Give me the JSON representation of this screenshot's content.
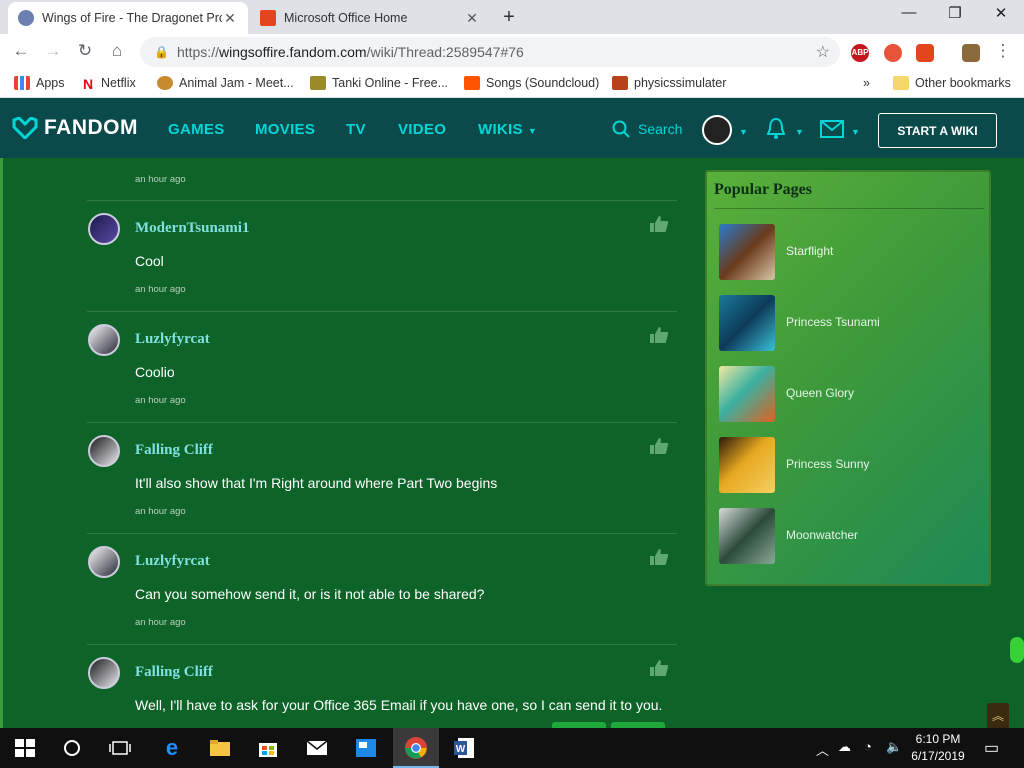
{
  "browser": {
    "tabs": [
      {
        "title": "Wings of Fire - The Dragonet Pro",
        "active": true
      },
      {
        "title": "Microsoft Office Home",
        "active": false
      }
    ],
    "url_scheme": "https://",
    "url_host": "wingsoffire.fandom.com",
    "url_path": "/wiki/Thread:2589547#76",
    "extensions": [
      "ABP"
    ],
    "bookmarks": [
      "Apps",
      "Netflix",
      "Animal Jam - Meet...",
      "Tanki Online - Free...",
      "Songs (Soundcloud)",
      "physicssimulater"
    ],
    "bookmarks_overflow": "»",
    "other_bookmarks": "Other bookmarks"
  },
  "fandom": {
    "logo": "FANDOM",
    "nav": [
      "GAMES",
      "MOVIES",
      "TV",
      "VIDEO",
      "WIKIS"
    ],
    "search_label": "Search",
    "start_wiki": "START A WIKI"
  },
  "thread": {
    "first_time": "an hour ago",
    "replies": [
      {
        "user": "ModernTsunami1",
        "text": "Cool",
        "time": "an hour ago"
      },
      {
        "user": "Luzlyfyrcat",
        "text": "Coolio",
        "time": "an hour ago"
      },
      {
        "user": "Falling Cliff",
        "text": "It'll also show that I'm Right around where Part Two begins",
        "time": "an hour ago"
      },
      {
        "user": "Luzlyfyrcat",
        "text": "Can you somehow send it, or is it not able to be shared?",
        "time": "an hour ago"
      },
      {
        "user": "Falling Cliff",
        "text": "Well, I'll have to ask for your Office 365 Email if you have one, so I can send it to you.",
        "time": ""
      }
    ]
  },
  "popular": {
    "title": "Popular Pages",
    "items": [
      "Starflight",
      "Princess Tsunami",
      "Queen Glory",
      "Princess Sunny",
      "Moonwatcher"
    ]
  },
  "taskbar": {
    "time": "6:10 PM",
    "date": "6/17/2019"
  },
  "colors": {
    "fandom_header": "#0b4a4b",
    "fandom_accent": "#00d6d6",
    "page_bg": "#0e6328",
    "username": "#7fe0e0"
  }
}
